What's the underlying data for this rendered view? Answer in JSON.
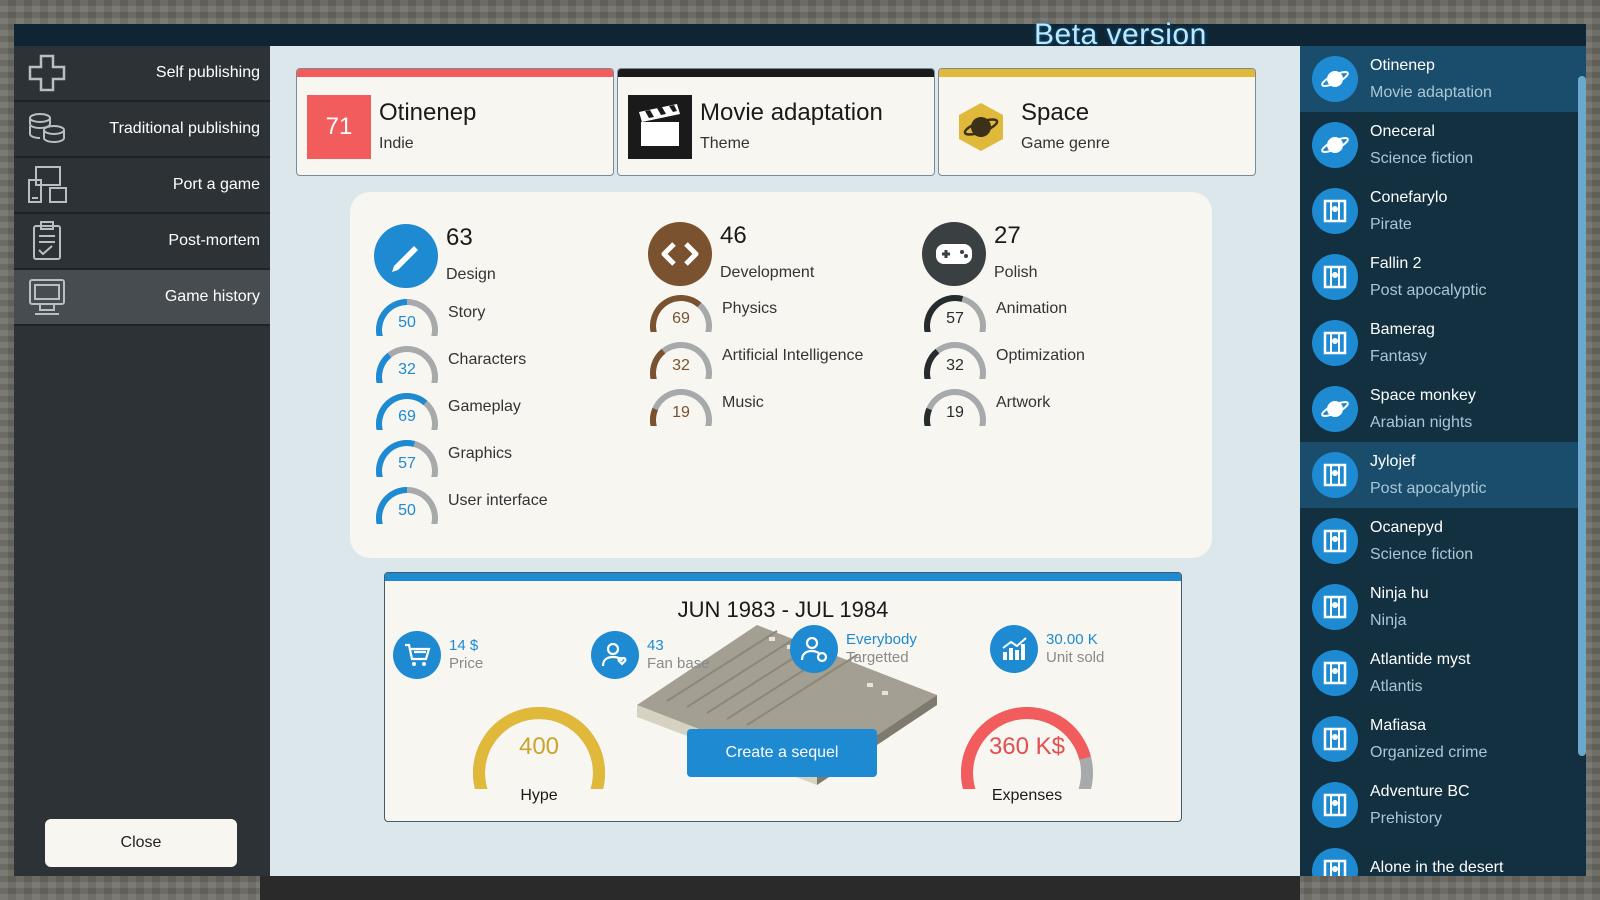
{
  "header": {
    "beta_label": "Beta version"
  },
  "sidebar": {
    "items": [
      {
        "label": "Self publishing",
        "icon": "plus-icon"
      },
      {
        "label": "Traditional publishing",
        "icon": "coins-icon"
      },
      {
        "label": "Port a game",
        "icon": "devices-icon"
      },
      {
        "label": "Post-mortem",
        "icon": "clipboard-icon"
      },
      {
        "label": "Game history",
        "icon": "computer-icon",
        "active": true
      }
    ],
    "close_label": "Close"
  },
  "cards": {
    "game": {
      "score": "71",
      "title": "Otinenep",
      "subtitle": "Indie",
      "accent": "#f25c5c"
    },
    "theme": {
      "title": "Movie adaptation",
      "subtitle": "Theme",
      "accent": "#1a1a1a"
    },
    "genre": {
      "title": "Space",
      "subtitle": "Game genre",
      "accent": "#e0b83a"
    }
  },
  "categories": [
    {
      "value": "63",
      "label": "Design",
      "color": "#1e8ad2",
      "skills": [
        {
          "value": "50",
          "label": "Story",
          "fraction": 0.5
        },
        {
          "value": "32",
          "label": "Characters",
          "fraction": 0.32
        },
        {
          "value": "69",
          "label": "Gameplay",
          "fraction": 0.69
        },
        {
          "value": "57",
          "label": "Graphics",
          "fraction": 0.57
        },
        {
          "value": "50",
          "label": "User interface",
          "fraction": 0.5
        }
      ]
    },
    {
      "value": "46",
      "label": "Development",
      "color": "#7a5230",
      "skills": [
        {
          "value": "69",
          "label": "Physics",
          "fraction": 0.69
        },
        {
          "value": "32",
          "label": "Artificial Intelligence",
          "fraction": 0.32
        },
        {
          "value": "19",
          "label": "Music",
          "fraction": 0.19
        }
      ]
    },
    {
      "value": "27",
      "label": "Polish",
      "color": "#262b2e",
      "skills": [
        {
          "value": "57",
          "label": "Animation",
          "fraction": 0.57
        },
        {
          "value": "32",
          "label": "Optimization",
          "fraction": 0.32
        },
        {
          "value": "19",
          "label": "Artwork",
          "fraction": 0.19
        }
      ]
    }
  ],
  "summary": {
    "period": "JUN 1983 - JUL 1984",
    "stats": [
      {
        "value": "14 $",
        "label": "Price",
        "icon": "cart-icon"
      },
      {
        "value": "43",
        "label": "Fan base",
        "icon": "fan-icon"
      },
      {
        "value": "Everybody",
        "label": "Targetted",
        "icon": "target-audience-icon"
      },
      {
        "value": "30.00 K",
        "label": "Unit sold",
        "icon": "chart-up-icon"
      }
    ],
    "hype": {
      "value": "400",
      "label": "Hype",
      "fraction": 1.0,
      "color": "#e0b83a"
    },
    "expenses": {
      "value": "360 K$",
      "label": "Expenses",
      "fraction": 0.85,
      "color": "#f25c5c"
    },
    "sequel_label": "Create a sequel"
  },
  "game_list": [
    {
      "name": "Otinenep",
      "genre": "Movie adaptation",
      "icon": "planet-icon",
      "selected": true
    },
    {
      "name": "Oneceral",
      "genre": "Science fiction",
      "icon": "planet-icon"
    },
    {
      "name": "Conefarylo",
      "genre": "Pirate",
      "icon": "map-icon"
    },
    {
      "name": "Fallin 2",
      "genre": "Post apocalyptic",
      "icon": "map-icon"
    },
    {
      "name": "Bamerag",
      "genre": "Fantasy",
      "icon": "map-icon"
    },
    {
      "name": "Space monkey",
      "genre": "Arabian nights",
      "icon": "planet-icon"
    },
    {
      "name": "Jylojef",
      "genre": "Post apocalyptic",
      "icon": "map-icon",
      "selected": true
    },
    {
      "name": "Ocanepyd",
      "genre": "Science fiction",
      "icon": "map-icon"
    },
    {
      "name": "Ninja hu",
      "genre": "Ninja",
      "icon": "map-icon"
    },
    {
      "name": "Atlantide myst",
      "genre": "Atlantis",
      "icon": "map-icon"
    },
    {
      "name": "Mafiasa",
      "genre": "Organized crime",
      "icon": "map-icon"
    },
    {
      "name": "Adventure BC",
      "genre": "Prehistory",
      "icon": "map-icon"
    },
    {
      "name": "Alone in the desert",
      "genre": "",
      "icon": "map-icon"
    }
  ]
}
